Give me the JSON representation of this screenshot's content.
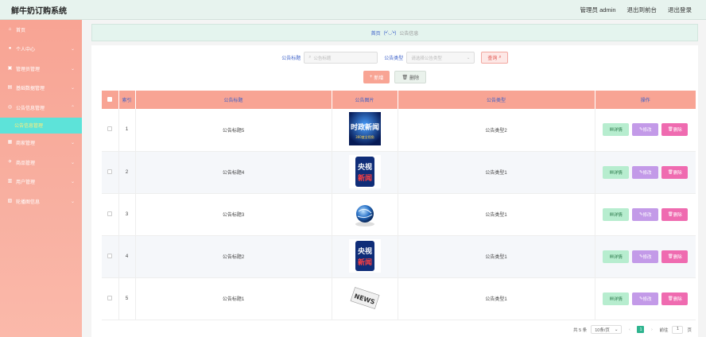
{
  "header": {
    "title": "鲜牛奶订购系统",
    "user": "管理员 admin",
    "front": "退出到前台",
    "logout": "退出登录"
  },
  "sidebar": {
    "items": [
      {
        "label": "首页",
        "icon": "home-icon",
        "sym": "⌂"
      },
      {
        "label": "个人中心",
        "icon": "user-icon",
        "sym": "●"
      },
      {
        "label": "管理员管理",
        "icon": "admin-icon",
        "sym": "▣"
      },
      {
        "label": "基础数据管理",
        "icon": "data-icon",
        "sym": "▤"
      },
      {
        "label": "公告信息管理",
        "icon": "notice-icon",
        "sym": "◎"
      }
    ],
    "active_sub": "公告信息管理",
    "items2": [
      {
        "label": "商家管理",
        "icon": "shop-icon",
        "sym": "▦"
      },
      {
        "label": "商品管理",
        "icon": "goods-icon",
        "sym": "✈"
      },
      {
        "label": "用户管理",
        "icon": "users-icon",
        "sym": "▥"
      },
      {
        "label": "轮播图信息",
        "icon": "carousel-icon",
        "sym": "▧"
      }
    ]
  },
  "breadcrumb": {
    "home": "首页",
    "face": "(•'◡'•)",
    "current": "公告信息"
  },
  "search": {
    "title_label": "公告标题",
    "title_placeholder": "公告标题",
    "type_label": "公告类型",
    "type_placeholder": "请选择公告类型",
    "button": "查询"
  },
  "toolbar": {
    "add": "新增",
    "delete": "删除"
  },
  "table": {
    "headers": [
      "索引",
      "公告标题",
      "公告图片",
      "公告类型",
      "操作"
    ],
    "rows": [
      {
        "index": "1",
        "title": "公告标题5",
        "type": "公告类型2",
        "image": "news-banner"
      },
      {
        "index": "2",
        "title": "公告标题4",
        "type": "公告类型1",
        "image": "cctv-news"
      },
      {
        "index": "3",
        "title": "公告标题3",
        "type": "公告类型1",
        "image": "globe"
      },
      {
        "index": "4",
        "title": "公告标题2",
        "type": "公告类型1",
        "image": "cctv-news"
      },
      {
        "index": "5",
        "title": "公告标题1",
        "type": "公告类型1",
        "image": "news-paper"
      }
    ],
    "row_buttons": {
      "detail": "详情",
      "edit": "修改",
      "delete": "删除"
    }
  },
  "pager": {
    "total": "共 5 条",
    "size": "10条/页",
    "page": "1",
    "goto": "前往",
    "goto_val": "1",
    "unit": "页"
  },
  "image_text": {
    "banner_main": "时政新闻",
    "banner_sub": "360度全视角",
    "cctv_top": "央视",
    "cctv_bottom": "新闻",
    "paper": "NEWS"
  }
}
